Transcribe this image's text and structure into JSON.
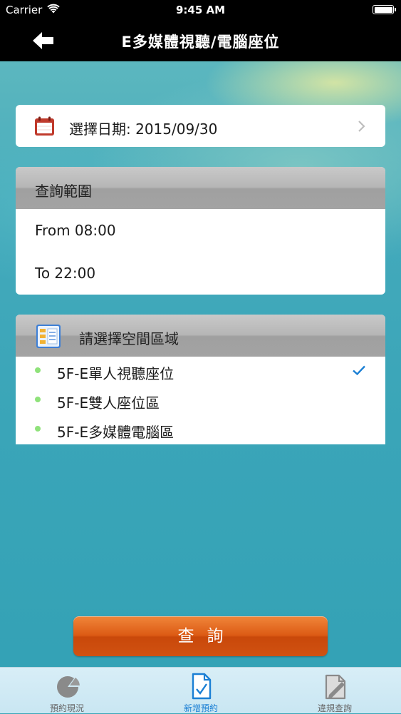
{
  "status_bar": {
    "carrier": "Carrier",
    "time": "9:45 AM",
    "wifi_icon": "wifi-icon",
    "battery_icon": "battery-icon"
  },
  "nav": {
    "title": "E多媒體視聽/電腦座位",
    "back_icon": "back-arrow-icon"
  },
  "date_selector": {
    "label": "選擇日期: 2015/09/30",
    "icon": "calendar-icon",
    "chevron_icon": "chevron-right-icon"
  },
  "query_range": {
    "header": "查詢範圍",
    "from": "From 08:00",
    "to": "To 22:00"
  },
  "area_selector": {
    "header": "請選擇空間區域",
    "icon": "list-icon",
    "items": [
      {
        "label": "5F-E單人視聽座位",
        "selected": true
      },
      {
        "label": "5F-E雙人座位區",
        "selected": false
      },
      {
        "label": "5F-E多媒體電腦區",
        "selected": false
      }
    ]
  },
  "query_button": {
    "label": "查詢"
  },
  "tabs": [
    {
      "label": "預約現況",
      "icon": "pie-chart-icon",
      "active": false
    },
    {
      "label": "新增預約",
      "icon": "new-document-icon",
      "active": true
    },
    {
      "label": "違規查詢",
      "icon": "edit-document-icon",
      "active": false
    }
  ],
  "colors": {
    "accent_blue": "#1a7fd4",
    "button_orange": "#dc5a14",
    "calendar_red": "#c0392b",
    "dot_green": "#8fe27a"
  }
}
